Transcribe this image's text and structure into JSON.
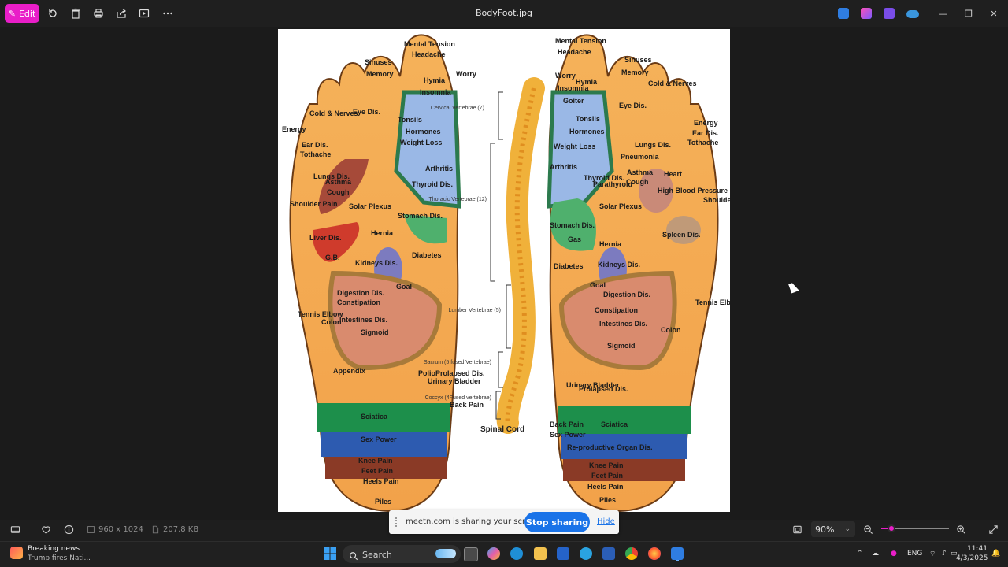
{
  "toolbar": {
    "edit_label": "Edit",
    "file_title": "BodyFoot.jpg",
    "icons": [
      "edit-icon",
      "rotate-icon",
      "delete-icon",
      "print-icon",
      "share-icon",
      "slideshow-icon",
      "more-icon"
    ]
  },
  "window_controls": [
    "minimize",
    "maximize",
    "close"
  ],
  "image": {
    "spine_labels": {
      "cervical": "Cervical Vertebrae (7)",
      "thoracic": "Thoracic Vertebrae (12)",
      "lumbar": "Lumber Vertebrae (5)",
      "sacrum": "Sacrum (5 fused Vertebrae)",
      "coccyx": "Coccyx (4Fused vertebrae)",
      "spinal_cord": "Spinal Cord"
    },
    "left_foot_labels": [
      "Mental Tension",
      "Headache",
      "Worry",
      "Sinuses",
      "Memory",
      "Hymia",
      "Insomnia",
      "Cold & Nerves",
      "Energy",
      "Eye Dis.",
      "Tonsils",
      "Hormones",
      "Weight Loss",
      "Ear Dis.",
      "Tothache",
      "Shoulder Pain",
      "Lungs Dis.",
      "Thyroid Dis.",
      "Arthritis",
      "Asthma",
      "Cough",
      "Solar Plexus",
      "Stomach Dis.",
      "Liver Dis.",
      "Hernia",
      "G.B.",
      "Kidneys Dis.",
      "Diabetes",
      "Goal",
      "Tennis Elbow",
      "Colon",
      "Digestion Dis.",
      "Constipation",
      "Intestines Dis.",
      "Sigmoid",
      "Appendix",
      "Polio",
      "Urinary Bladder",
      "Prolapsed Dis.",
      "Back Pain",
      "Sciatica",
      "Sex Power",
      "Knee Pain",
      "Feet Pain",
      "Heels Pain",
      "Piles"
    ],
    "right_foot_labels": [
      "Mental Tension",
      "Headache",
      "Worry",
      "Hymia",
      "Insomnia",
      "Sinuses",
      "Memory",
      "Goiter",
      "Cold & Nerves",
      "Eye Dis.",
      "Tonsils",
      "Hormones",
      "Energy",
      "Ear Dis.",
      "Tothache",
      "Lungs Dis.",
      "Weight Loss",
      "Pneumonia",
      "Arthritis",
      "Thyroid Dis.",
      "Parathyroid",
      "Asthma",
      "Cough",
      "Heart",
      "High Blood Pressure",
      "Shoulder Pain",
      "Solar Plexus",
      "Stomach Dis.",
      "Gas",
      "Spleen Dis.",
      "Hernia",
      "Diabetes",
      "Kidneys Dis.",
      "Goal",
      "Digestion Dis.",
      "Constipation",
      "Intestines Dis.",
      "Sigmoid",
      "Colon",
      "Tennis Elbow",
      "Urinary Bladder",
      "Prolapsed Dis.",
      "Back Pain",
      "Sciatica",
      "Sex Power",
      "Re-productive Organ Dis.",
      "Knee Pain",
      "Feet Pain",
      "Heels Pain",
      "Piles"
    ]
  },
  "bottom_bar": {
    "dimensions": "960 x 1024",
    "file_size": "207.8 KB",
    "zoom": "90%",
    "zoom_fraction": 0.1
  },
  "share_banner": {
    "text": "meetn.com is sharing your screen.",
    "stop_label": "Stop sharing",
    "hide_label": "Hide"
  },
  "taskbar": {
    "news_title": "Breaking news",
    "news_sub": "Trump fires Nati...",
    "search_placeholder": "Search",
    "language": "ENG",
    "time": "11:41",
    "date": "4/3/2025"
  }
}
